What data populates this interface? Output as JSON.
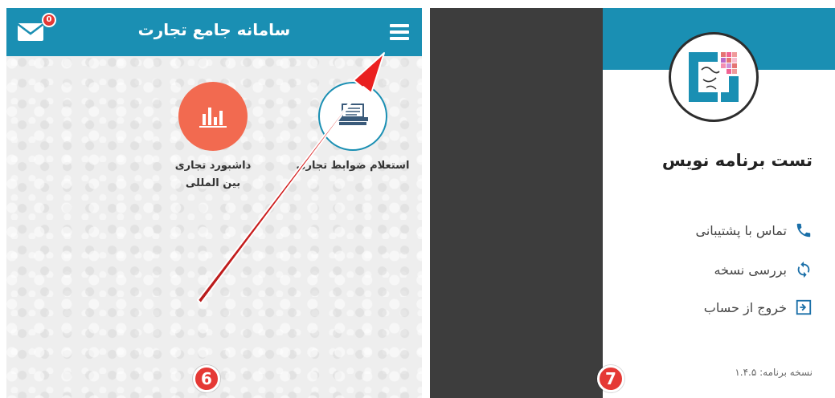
{
  "screen6": {
    "header": {
      "title": "سامانه جامع تجارت",
      "mail_icon": "envelope-icon",
      "mail_badge_count": "0",
      "menu_icon": "hamburger-menu-icon"
    },
    "tiles": [
      {
        "label_line1": "استعلام ضوابط تجاری",
        "label_line2": "",
        "icon": "document-stack-icon"
      },
      {
        "label_line1": "داشبورد تجاری",
        "label_line2": "بین المللی",
        "icon": "bar-chart-icon"
      }
    ],
    "step_number": "6",
    "annotation": "red-arrow-pointing-to-menu"
  },
  "screen7": {
    "user_name": "تست برنامه نویس",
    "menu": [
      {
        "label": "تماس با پشتیبانی",
        "icon": "phone-icon"
      },
      {
        "label": "بررسی نسخه",
        "icon": "sync-icon"
      },
      {
        "label": "خروج از حساب",
        "icon": "logout-icon"
      }
    ],
    "version_text": "نسخه برنامه: ۱.۴.۵",
    "step_number": "7",
    "logo": "iran-trade-system-logo"
  },
  "colors": {
    "primary": "#1a8fb3",
    "dashboard_tile": "#f26a50",
    "badge_red": "#e53935",
    "overlay_dark": "#3d3d3d"
  }
}
